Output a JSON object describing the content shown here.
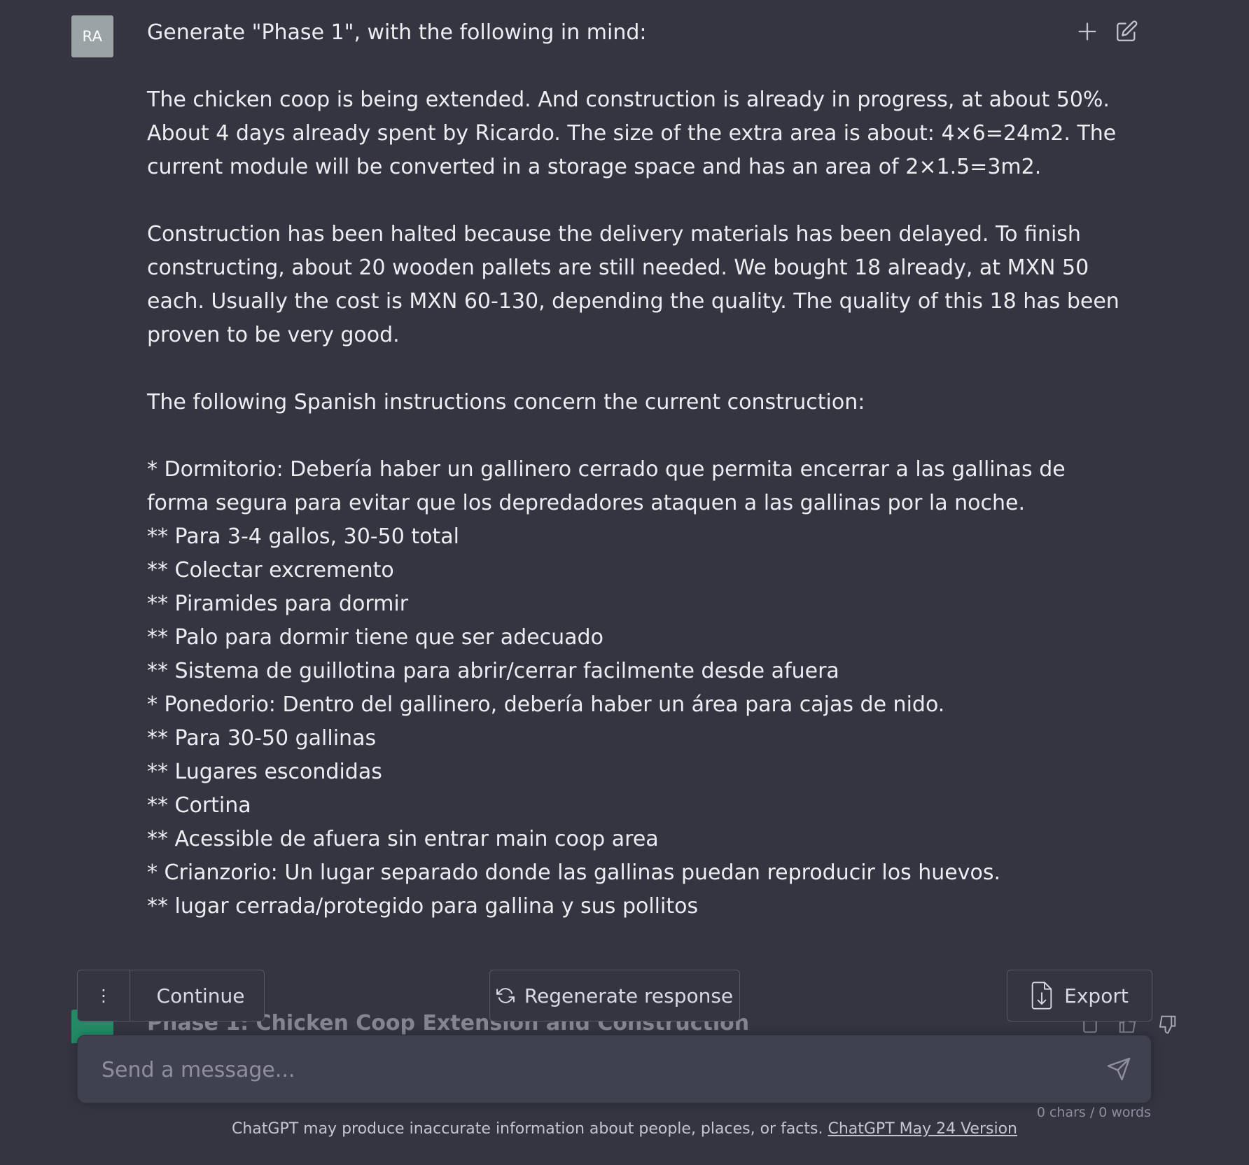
{
  "user": {
    "avatar_initials": "RA"
  },
  "message": {
    "lines": [
      "Generate \"Phase 1\", with the following in mind:",
      "",
      "The chicken coop is being extended. And construction is already in progress, at about 50%.",
      "About 4 days already spent by Ricardo. The size of the extra area is about: 4×6=24m2. The",
      "current module will be converted in a storage space and has an area of 2×1.5=3m2.",
      "",
      "Construction has been halted because the delivery materials has been delayed. To finish",
      "constructing, about 20 wooden pallets are still needed. We bought 18 already, at MXN 50",
      "each. Usually the cost is MXN 60-130, depending the quality. The quality of this 18 has been",
      "proven to be very good.",
      "",
      "The following Spanish instructions concern the current construction:",
      "",
      "* Dormitorio: Debería haber un gallinero cerrado que permita encerrar a las gallinas de",
      "forma segura para evitar que los depredadores ataquen a las gallinas por la noche.",
      "** Para 3-4 gallos, 30-50 total",
      "** Colectar excremento",
      "** Piramides para dormir",
      "** Palo para dormir tiene que ser adecuado",
      "** Sistema de guillotina para abrir/cerrar facilmente desde afuera",
      "* Ponedorio: Dentro del gallinero, debería haber un área para cajas de nido.",
      "** Para 30-50 gallinas",
      "** Lugares escondidas",
      "** Cortina",
      "** Acessible de afuera sin entrar main coop area",
      "* Crianzorio: Un lugar separado donde las gallinas puedan reproducir los huevos.",
      "** lugar cerrada/protegido para gallina y sus pollitos"
    ]
  },
  "top_icons": [
    "plus-icon",
    "edit-icon"
  ],
  "partial_reply": {
    "title": "Phase 1: Chicken Coop Extension and Construction"
  },
  "toolbar": {
    "more_label": "⋮",
    "continue_label": "Continue",
    "regenerate_label": "Regenerate response",
    "export_label": "Export"
  },
  "composer": {
    "placeholder": "Send a message...",
    "counter": "0 chars / 0 words"
  },
  "footer": {
    "text": "ChatGPT may produce inaccurate information about people, places, or facts. ",
    "link": "ChatGPT May 24 Version"
  },
  "colors": {
    "background": "#343541",
    "input_bg": "#40414f",
    "avatar_bg": "#9ca3a7",
    "text": "#ececf1"
  }
}
